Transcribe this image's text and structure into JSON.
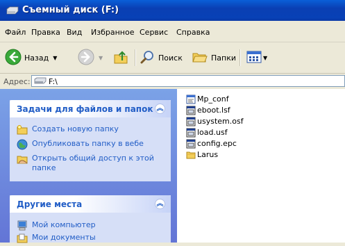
{
  "window": {
    "title": "Съемный диск (F:)"
  },
  "menu": [
    "Файл",
    "Правка",
    "Вид",
    "Избранное",
    "Сервис",
    "Справка"
  ],
  "toolbar": {
    "back_label": "Назад",
    "search_label": "Поиск",
    "folders_label": "Папки"
  },
  "address": {
    "label": "Адрес:",
    "value": "F:\\"
  },
  "file_tasks": {
    "title": "Задачи для файлов и папок",
    "items": [
      {
        "label": "Создать новую папку",
        "icon": "new-folder-icon"
      },
      {
        "label": "Опубликовать папку в вебе",
        "icon": "globe-icon"
      },
      {
        "label": "Открыть общий доступ к этой папке",
        "icon": "share-folder-icon"
      }
    ]
  },
  "other_places": {
    "title": "Другие места",
    "items": [
      {
        "label": "Мой компьютер",
        "icon": "computer-icon"
      },
      {
        "label": "Мои документы",
        "icon": "documents-icon"
      }
    ]
  },
  "files": [
    {
      "name": "Mp_conf",
      "icon": "config-file-icon"
    },
    {
      "name": "eboot.lsf",
      "icon": "file-icon"
    },
    {
      "name": "usystem.osf",
      "icon": "file-icon"
    },
    {
      "name": "load.usf",
      "icon": "file-icon"
    },
    {
      "name": "config.epc",
      "icon": "file-icon"
    },
    {
      "name": "Larus",
      "icon": "folder-icon"
    }
  ],
  "colors": {
    "titlebar": "#0a48c8",
    "taskpane": "#6f8ee0",
    "link": "#215dc6"
  }
}
